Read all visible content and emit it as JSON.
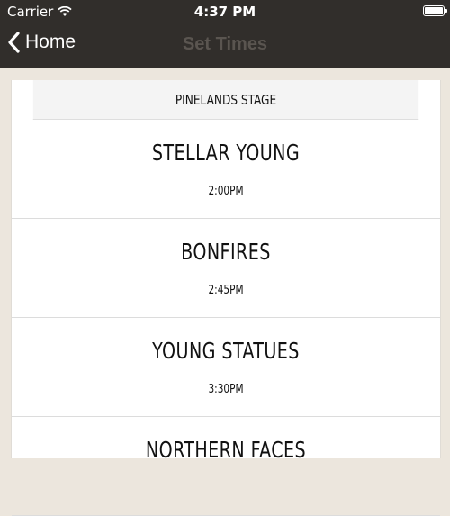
{
  "status_bar": {
    "carrier": "Carrier",
    "time": "4:37 PM",
    "wifi_icon": "wifi-icon",
    "battery_icon": "battery-icon"
  },
  "nav_bar": {
    "back_label": "Home",
    "back_icon": "chevron-left-icon",
    "title": "Set Times"
  },
  "stage": {
    "name": "PINELANDS STAGE",
    "sets": [
      {
        "band": "STELLAR YOUNG",
        "time": "2:00PM"
      },
      {
        "band": "BONFIRES",
        "time": "2:45PM"
      },
      {
        "band": "YOUNG STATUES",
        "time": "3:30PM"
      },
      {
        "band": "NORTHERN FACES",
        "time": ""
      }
    ]
  },
  "colors": {
    "bar_background": "#312e2b",
    "page_background": "#ece6dd",
    "nav_title": "#5a5550"
  }
}
